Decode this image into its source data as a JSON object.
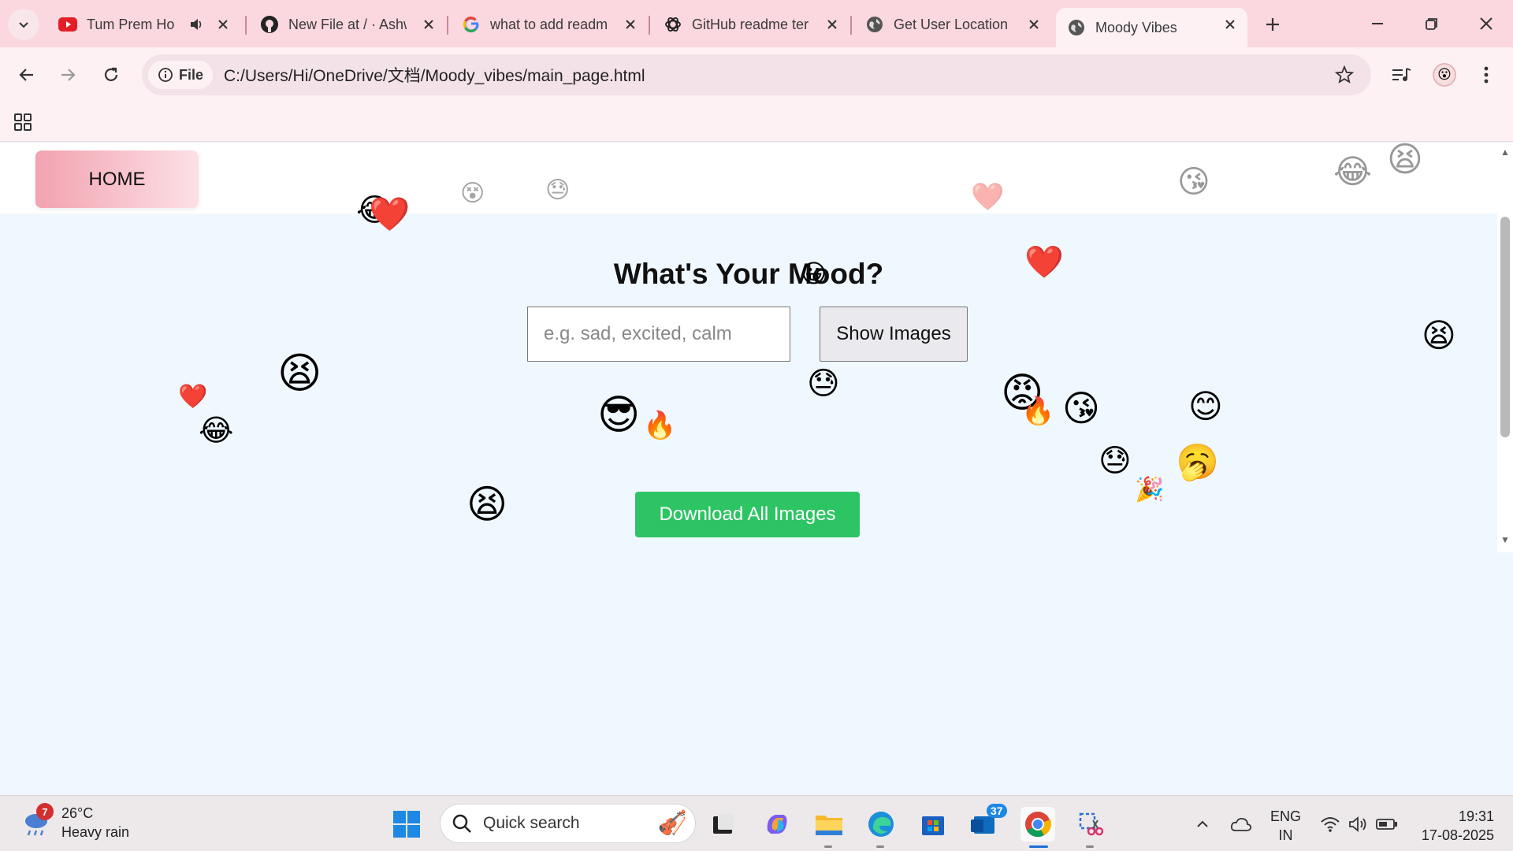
{
  "browser": {
    "tabs": [
      {
        "title": "Tum Prem Ho",
        "favicon": "youtube-icon",
        "muted_icon": "speaker-icon"
      },
      {
        "title": "New File at / · Ashw",
        "favicon": "github-icon"
      },
      {
        "title": "what to add readm",
        "favicon": "google-icon"
      },
      {
        "title": "GitHub readme ter",
        "favicon": "chatgpt-icon"
      },
      {
        "title": "Get User Location",
        "favicon": "globe-icon"
      },
      {
        "title": "Moody Vibes",
        "favicon": "globe-icon",
        "active": true
      }
    ],
    "address": {
      "chip_label": "File",
      "url": "C:/Users/Hi/OneDrive/文档/Moody_vibes/main_page.html"
    }
  },
  "page": {
    "home_label": "HOME",
    "heading": "What's Your Mood?",
    "input_placeholder": "e.g. sad, excited, calm",
    "show_button": "Show Images",
    "download_button": "Download All Images",
    "floating_emojis": [
      "😂",
      "❤️",
      "😵",
      "😓",
      "❤️",
      "😘",
      "😂",
      "😫",
      "❤️",
      "😫",
      "❤️",
      "😂",
      "😎",
      "🔥",
      "😓",
      "😡",
      "🔥",
      "😘",
      "😊",
      "😓",
      "🥱",
      "🎉",
      "😫",
      "😫",
      "😀"
    ]
  },
  "taskbar": {
    "weather": {
      "badge": "7",
      "temp": "26°C",
      "desc": "Heavy rain"
    },
    "search_label": "Quick search",
    "store_badge": "37",
    "language": {
      "line1": "ENG",
      "line2": "IN"
    },
    "clock": {
      "time": "19:31",
      "date": "17-08-2025"
    }
  },
  "colors": {
    "tabstrip": "#fbd7df",
    "toolbar": "#fdf1f4",
    "page_bg": "#f0f8ff",
    "download_green": "#2dc463",
    "home_gradient_start": "#f2a3b0"
  }
}
